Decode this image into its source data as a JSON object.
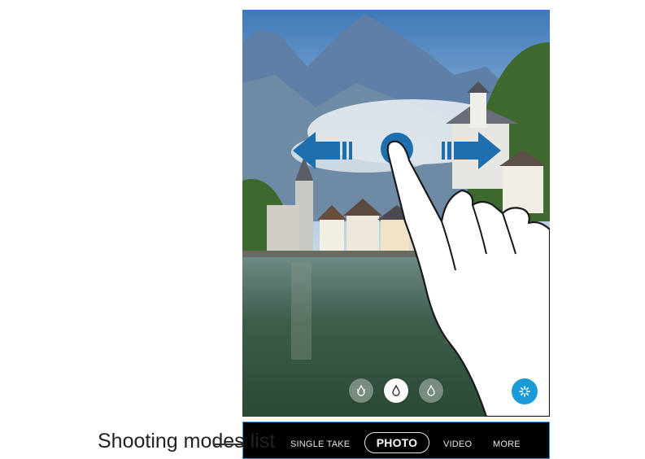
{
  "camera": {
    "modes": {
      "items": [
        "SINGLE TAKE",
        "PHOTO",
        "VIDEO",
        "MORE"
      ],
      "selected": "PHOTO"
    },
    "filters": [
      "filter-effect-icon",
      "filter-effect-icon",
      "filter-effect-icon"
    ],
    "effect_button": "shutter-effect-icon",
    "accent_color": "#1a9bd7",
    "gesture": "swipe-left-right"
  },
  "callout": {
    "label": "Shooting modes list"
  }
}
